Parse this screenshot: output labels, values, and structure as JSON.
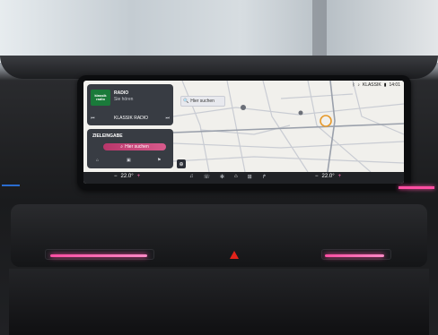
{
  "status": {
    "source": "KLASSIK",
    "time": "14:01"
  },
  "radio": {
    "header": "RADIO",
    "subtitle": "Sie hören",
    "station": "KLASSIK RADIO",
    "logo_text": "klassik radio"
  },
  "destination": {
    "header": "ZIELEINGABE",
    "search_label": "Hier suchen"
  },
  "map": {
    "search_label": "Hier suchen"
  },
  "climate": {
    "left_temp": "22.0°",
    "right_temp": "22.0°",
    "minus": "−",
    "plus": "+"
  },
  "colors": {
    "accent": "#d85a8c",
    "ambient": "#ff4ea3",
    "hazard": "#e2231a"
  }
}
